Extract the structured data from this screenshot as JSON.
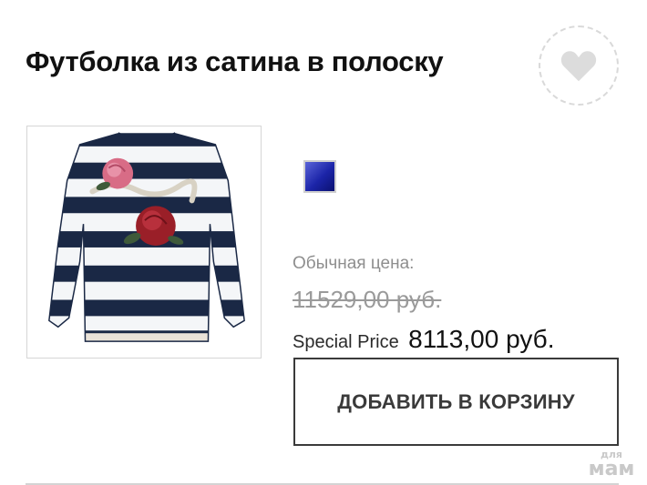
{
  "product": {
    "title": "Футболка из сатина в полоску",
    "image_alt": "Футболка из сатина в полоску",
    "swatch": {
      "name": "blue-swatch",
      "color": "#1b24a8"
    }
  },
  "price": {
    "regular_label": "Обычная цена:",
    "regular_value": "11529,00 руб.",
    "special_label": "Special Price",
    "special_value": "8113,00 руб."
  },
  "actions": {
    "add_to_cart": "ДОБАВИТЬ В КОРЗИНУ",
    "wishlist_icon": "heart-icon"
  },
  "watermark": {
    "line1": "для",
    "line2": "мам"
  },
  "colors": {
    "stripe_navy": "#1a2845",
    "rose_red": "#9a1f28",
    "rose_pink": "#d86c86",
    "button_border": "#3a3a3a"
  }
}
